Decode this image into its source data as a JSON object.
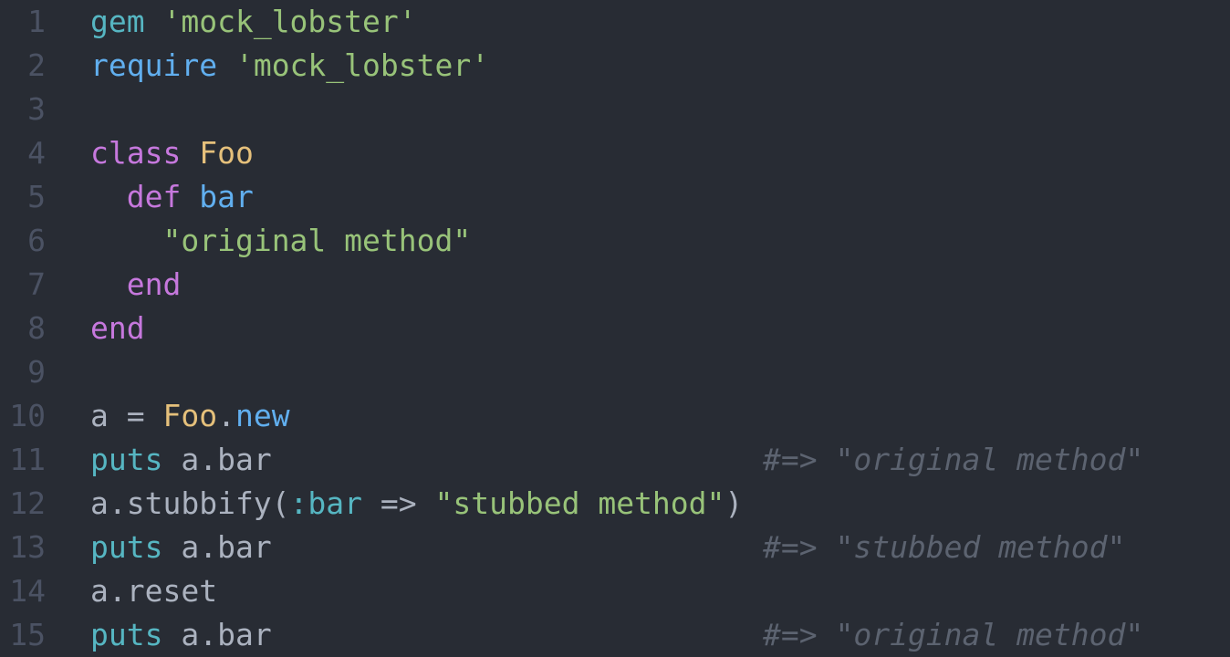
{
  "editor": {
    "language": "ruby",
    "theme_colors": {
      "background": "#282c34",
      "line_number": "#4b5263",
      "plain": "#abb2bf",
      "keyword": "#c678dd",
      "builtin": "#56b6c2",
      "function": "#61afef",
      "string": "#98c379",
      "constant": "#e5c07b",
      "comment": "#5c6370"
    },
    "lines": [
      {
        "n": "1",
        "tokens": [
          {
            "t": "gem",
            "c": "kw-module"
          },
          {
            "t": " ",
            "c": "plain"
          },
          {
            "t": "'mock_lobster'",
            "c": "str"
          }
        ]
      },
      {
        "n": "2",
        "tokens": [
          {
            "t": "require",
            "c": "kw-blue"
          },
          {
            "t": " ",
            "c": "plain"
          },
          {
            "t": "'mock_lobster'",
            "c": "str"
          }
        ]
      },
      {
        "n": "3",
        "tokens": []
      },
      {
        "n": "4",
        "tokens": [
          {
            "t": "class",
            "c": "kw-purple"
          },
          {
            "t": " ",
            "c": "plain"
          },
          {
            "t": "Foo",
            "c": "const"
          }
        ]
      },
      {
        "n": "5",
        "tokens": [
          {
            "t": "  ",
            "c": "plain"
          },
          {
            "t": "def",
            "c": "kw-purple"
          },
          {
            "t": " ",
            "c": "plain"
          },
          {
            "t": "bar",
            "c": "kw-blue"
          }
        ]
      },
      {
        "n": "6",
        "tokens": [
          {
            "t": "    ",
            "c": "plain"
          },
          {
            "t": "\"original method\"",
            "c": "str"
          }
        ]
      },
      {
        "n": "7",
        "tokens": [
          {
            "t": "  ",
            "c": "plain"
          },
          {
            "t": "end",
            "c": "kw-purple"
          }
        ]
      },
      {
        "n": "8",
        "tokens": [
          {
            "t": "end",
            "c": "kw-purple"
          }
        ]
      },
      {
        "n": "9",
        "tokens": []
      },
      {
        "n": "10",
        "tokens": [
          {
            "t": "a = ",
            "c": "plain"
          },
          {
            "t": "Foo",
            "c": "const"
          },
          {
            "t": ".",
            "c": "plain"
          },
          {
            "t": "new",
            "c": "kw-blue"
          }
        ]
      },
      {
        "n": "11",
        "tokens": [
          {
            "t": "puts",
            "c": "kw-module"
          },
          {
            "t": " a.bar",
            "c": "plain"
          }
        ],
        "comment": "#=> \"original method\""
      },
      {
        "n": "12",
        "tokens": [
          {
            "t": "a.stubbify(",
            "c": "plain"
          },
          {
            "t": ":bar",
            "c": "sym"
          },
          {
            "t": " => ",
            "c": "plain"
          },
          {
            "t": "\"stubbed method\"",
            "c": "str"
          },
          {
            "t": ")",
            "c": "plain"
          }
        ]
      },
      {
        "n": "13",
        "tokens": [
          {
            "t": "puts",
            "c": "kw-module"
          },
          {
            "t": " a.bar",
            "c": "plain"
          }
        ],
        "comment": "#=> \"stubbed method\""
      },
      {
        "n": "14",
        "tokens": [
          {
            "t": "a.reset",
            "c": "plain"
          }
        ]
      },
      {
        "n": "15",
        "tokens": [
          {
            "t": "puts",
            "c": "kw-module"
          },
          {
            "t": " a.bar",
            "c": "plain"
          }
        ],
        "comment": "#=> \"original method\""
      }
    ]
  }
}
